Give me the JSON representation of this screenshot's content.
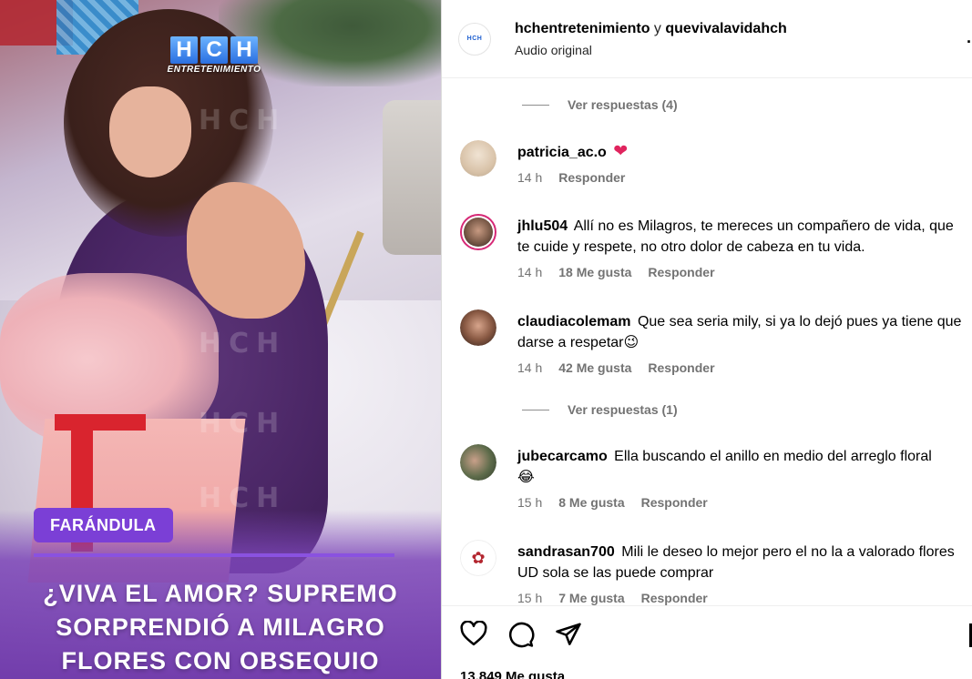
{
  "media": {
    "logo_letters": [
      "H",
      "C",
      "H"
    ],
    "logo_sub": "ENTRETENIMIENTO",
    "watermark": "HCH",
    "tag": "FARÁNDULA",
    "headline": [
      "¿VIVA EL AMOR? SUPREMO",
      "SORPRENDIÓ A MILAGRO",
      "FLORES CON OBSEQUIO"
    ]
  },
  "header": {
    "user1": "hchentretenimiento",
    "conj": "y",
    "user2": "quevivalavidahch",
    "audio": "Audio original",
    "avatar_text": "HCH"
  },
  "comments": {
    "view_replies_1": "Ver respuestas (4)",
    "view_replies_2": "Ver respuestas (1)",
    "items": [
      {
        "user": "patricia_ac.o",
        "text": "",
        "emoji": "heart",
        "time": "14 h",
        "likes": "",
        "reply": "Responder"
      },
      {
        "user": "jhlu504",
        "text": "Allí no es Milagros, te mereces un compañero de vida, que te cuide y respete, no otro dolor de cabeza en tu vida.",
        "time": "14 h",
        "likes": "18 Me gusta",
        "reply": "Responder"
      },
      {
        "user": "claudiacolemam",
        "text": "Que sea seria mily, si ya lo dejó pues ya tiene que darse a respetar",
        "emoji_text": "😉",
        "time": "14 h",
        "likes": "42 Me gusta",
        "reply": "Responder"
      },
      {
        "user": "jubecarcamo",
        "text": "Ella buscando el anillo en medio del arreglo floral",
        "emoji_text": "😂",
        "time": "15 h",
        "likes": "8 Me gusta",
        "reply": "Responder"
      },
      {
        "user": "sandrasan700",
        "text": "Mili le deseo lo mejor pero el no la a valorado flores UD sola se las puede comprar",
        "time": "15 h",
        "likes": "7 Me gusta",
        "reply": "Responder"
      }
    ]
  },
  "actions": {
    "icons": [
      "heart-icon",
      "comment-icon",
      "share-icon",
      "bookmark-icon"
    ],
    "likes": "13.849 Me gusta"
  },
  "colors": {
    "tag_bg": "#7b3fd6",
    "meta_text": "#737373",
    "story_ring": "#d62976",
    "heart": "#e0245e"
  }
}
